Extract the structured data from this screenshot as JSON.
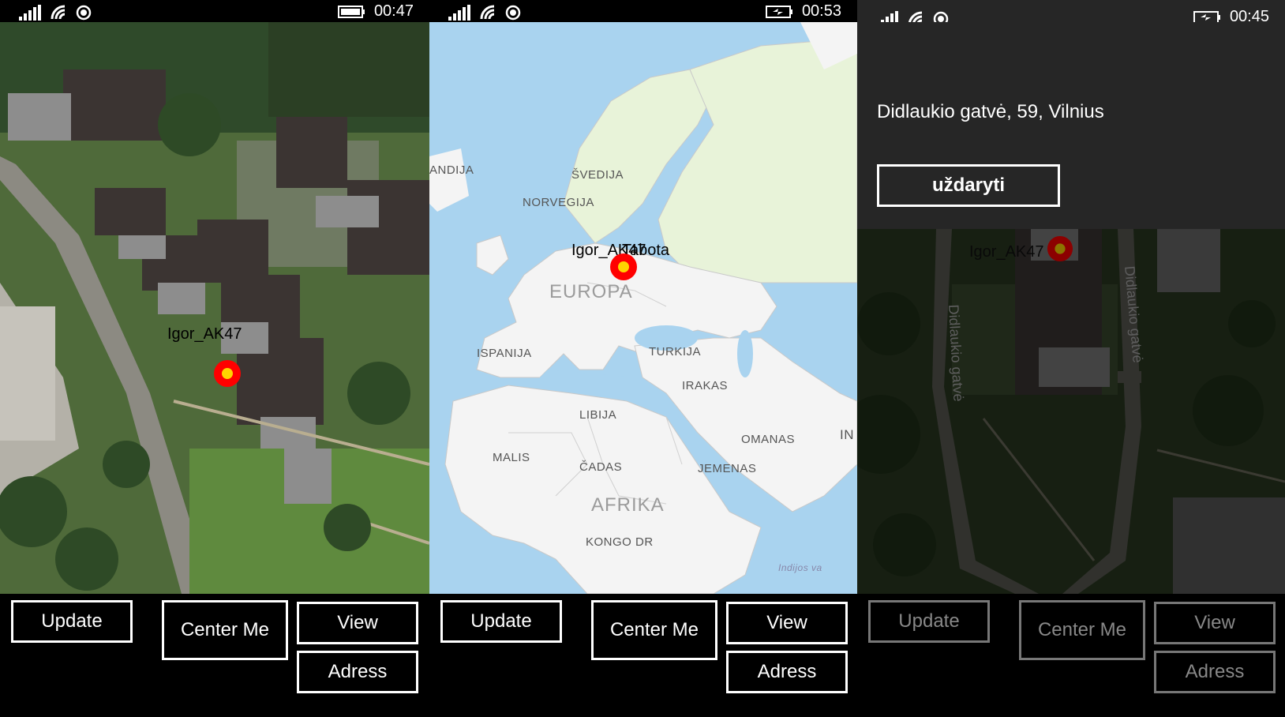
{
  "screens": [
    {
      "status": {
        "time": "00:47",
        "battery": "battery-full-icon"
      },
      "map": {
        "style": "aerial",
        "pin_label": "Igor_AK47"
      },
      "buttons": {
        "update": "Update",
        "center": "Center Me",
        "view": "View",
        "adress": "Adress"
      }
    },
    {
      "status": {
        "time": "00:53",
        "battery": "battery-charging-icon"
      },
      "map": {
        "style": "road",
        "pin_label": "Igor_AK47",
        "overlap_label": "Tabota",
        "labels": [
          "ANDIJA",
          "ŠVEDIJA",
          "NORVEGIJA",
          "EUROPA",
          "ISPANIJA",
          "TURKIJA",
          "IRAKAS",
          "LIBIJA",
          "MALIS",
          "ČADAS",
          "OMANAS",
          "JEMENAS",
          "AFRIKA",
          "KONGO DR",
          "IN",
          "Indijos va"
        ]
      },
      "buttons": {
        "update": "Update",
        "center": "Center Me",
        "view": "View",
        "adress": "Adress"
      }
    },
    {
      "status": {
        "time": "00:45",
        "battery": "battery-charging-icon"
      },
      "popup": {
        "address": "Didlaukio gatvė, 59, Vilnius",
        "close_label": "uždaryti"
      },
      "map": {
        "style": "aerial-dimmed",
        "pin_label": "Igor_AK47",
        "streets": [
          "Didlaukio gatvė",
          "Didlaukio gatvė"
        ]
      },
      "buttons": {
        "update": "Update",
        "center": "Center Me",
        "view": "View",
        "adress": "Adress"
      }
    }
  ],
  "colors": {
    "pin_outer": "#ff0000",
    "pin_inner": "#ffd400",
    "background": "#000000",
    "popup_bg": "#262626"
  }
}
